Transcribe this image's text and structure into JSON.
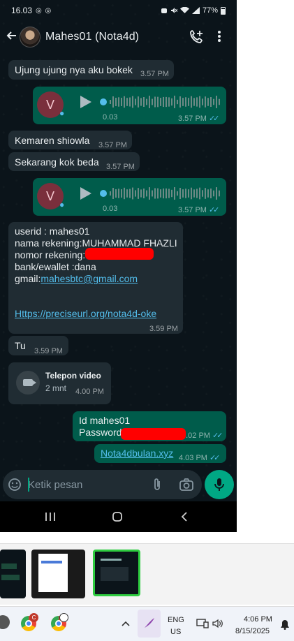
{
  "status": {
    "time": "16.03",
    "left_icons": "◎ ◎",
    "battery": "77%"
  },
  "header": {
    "contact": "Mahes01 (Nota4d)"
  },
  "messages": {
    "m1": {
      "text": "Ujung ujung nya aku bokek",
      "time": "3.57 PM"
    },
    "voice1": {
      "avatar": "V",
      "duration": "0.03",
      "time": "3.57 PM"
    },
    "m2": {
      "text": "Kemaren shiowla",
      "time": "3.57 PM"
    },
    "m3": {
      "text": "Sekarang kok beda",
      "time": "3.57 PM"
    },
    "voice2": {
      "avatar": "V",
      "duration": "0.03",
      "time": "3.57 PM"
    },
    "info": {
      "line1": "userid : mahes01",
      "line2": "nama rekening:MUHAMMAD FHAZLI",
      "line3": "nomor rekening:",
      "line4": "bank/ewallet :dana",
      "line5_prefix": "gmail:",
      "email": "mahesbtc@gmail.com",
      "url": "Https://preciseurl.org/nota4d-oke",
      "time": "3.59 PM"
    },
    "m4": {
      "text": "Tu",
      "time": "3.59 PM"
    },
    "call": {
      "title": "Telepon video",
      "duration": "2 mnt",
      "time": "4.00 PM"
    },
    "out1": {
      "line1": "Id mahes01",
      "line2": "Password",
      "time": "4.02 PM"
    },
    "out2": {
      "link": "Nota4dbulan.xyz",
      "time": "4.03 PM"
    }
  },
  "composer": {
    "placeholder": "Ketik pesan"
  },
  "taskbar": {
    "lang1": "ENG",
    "lang2": "US",
    "clock_time": "4:06 PM",
    "clock_date": "8/15/2025",
    "chrome_badge": "C"
  },
  "colors": {
    "incoming": "#202c33",
    "outgoing": "#005c4b",
    "accent": "#00a884",
    "link": "#53bdeb"
  }
}
